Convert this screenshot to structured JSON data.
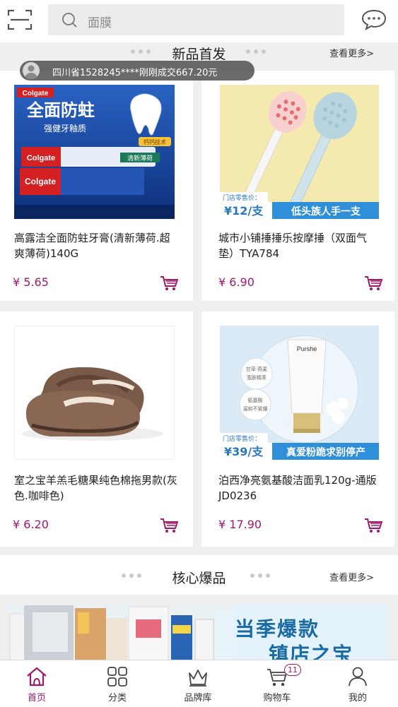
{
  "header": {
    "search_placeholder": "面膜",
    "icons": [
      "scan-icon",
      "search-icon",
      "chat-icon"
    ]
  },
  "new_section": {
    "title": "新品首发",
    "more": "查看更多>"
  },
  "toast": {
    "text": "四川省1528245****刚刚成交667.20元"
  },
  "products": [
    {
      "name": "高露洁全面防蛀牙膏(清新薄荷.超爽薄荷)140G",
      "price": "¥ 5.65",
      "image": {
        "brand": "Colgate",
        "brand_cn": "高露洁",
        "headline": "全面防蛀",
        "sub": "强健牙釉质",
        "tag": "钙钙技术",
        "flavor": "清新薄荷"
      }
    },
    {
      "name": "城市小铺捶捶乐按摩捶（双面气垫）TYA784",
      "price": "¥ 6.90",
      "image": {
        "store_price_label": "门店零售价：",
        "store_price": "¥12/支",
        "slogan": "低头族人手一支"
      }
    },
    {
      "name": "室之宝羊羔毛糖果纯色棉拖男款(灰色.咖啡色)",
      "price": "¥ 6.20",
      "image": {}
    },
    {
      "name": "泊西净亮氨基酸洁面乳120g-通版JD0236",
      "price": "¥ 17.90",
      "image": {
        "brand": "Purshe",
        "badge1": "甘草·燕麦 宽肤精萃",
        "badge2": "氨基酸 温和不紧绷",
        "store_price_label": "门店零售价：",
        "store_price": "¥39/支",
        "slogan": "真爱粉跪求别停产"
      }
    }
  ],
  "core_section": {
    "title": "核心爆品",
    "more": "查看更多>"
  },
  "banner": {
    "line1": "当季爆款",
    "line2": "镇店之宝"
  },
  "tabs": [
    {
      "label": "首页",
      "icon": "home-icon",
      "active": true
    },
    {
      "label": "分类",
      "icon": "category-icon",
      "active": false
    },
    {
      "label": "品牌库",
      "icon": "crown-icon",
      "active": false
    },
    {
      "label": "购物车",
      "icon": "cart-icon",
      "active": false,
      "badge": "11"
    },
    {
      "label": "我的",
      "icon": "user-icon",
      "active": false
    }
  ],
  "colors": {
    "accent": "#a0186a",
    "background": "#efefef"
  }
}
